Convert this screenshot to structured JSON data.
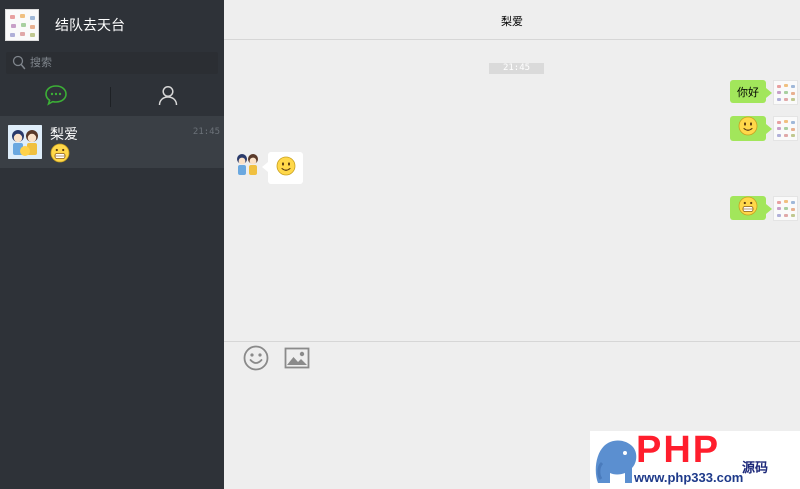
{
  "profile": {
    "name": "结队去天台"
  },
  "search": {
    "placeholder": "搜索"
  },
  "tabs": [
    {
      "id": "chat",
      "icon": "chat-bubble-icon",
      "active": true,
      "color": "#3caf36"
    },
    {
      "id": "contacts",
      "icon": "person-icon",
      "active": false,
      "color": "#d8d8d8"
    }
  ],
  "conversations": [
    {
      "name": "梨爱",
      "time": "21:45",
      "preview_icon": "grin-emoji-icon",
      "selected": true
    }
  ],
  "chat": {
    "title": "梨爱",
    "time_divider": "21:45",
    "messages": [
      {
        "side": "right",
        "type": "text",
        "text": "你好"
      },
      {
        "side": "right",
        "type": "emoji",
        "icon": "smile-emoji-icon"
      },
      {
        "side": "left",
        "type": "emoji",
        "icon": "smile-emoji-icon"
      },
      {
        "side": "right",
        "type": "emoji",
        "icon": "grin-emoji-icon"
      }
    ]
  },
  "composer": {
    "tools": [
      "emoji-icon",
      "image-icon"
    ]
  },
  "watermark": {
    "brand": "PHP",
    "brand_cn": "源码",
    "url": "www.php333.com"
  },
  "colors": {
    "sidebar": "#2e3238",
    "selected_item": "#3a3f45",
    "bubble_self": "#a2e65b",
    "accent_green": "#3caf36",
    "watermark_red": "#ff1e2d",
    "watermark_blue": "#1e3a8a"
  }
}
